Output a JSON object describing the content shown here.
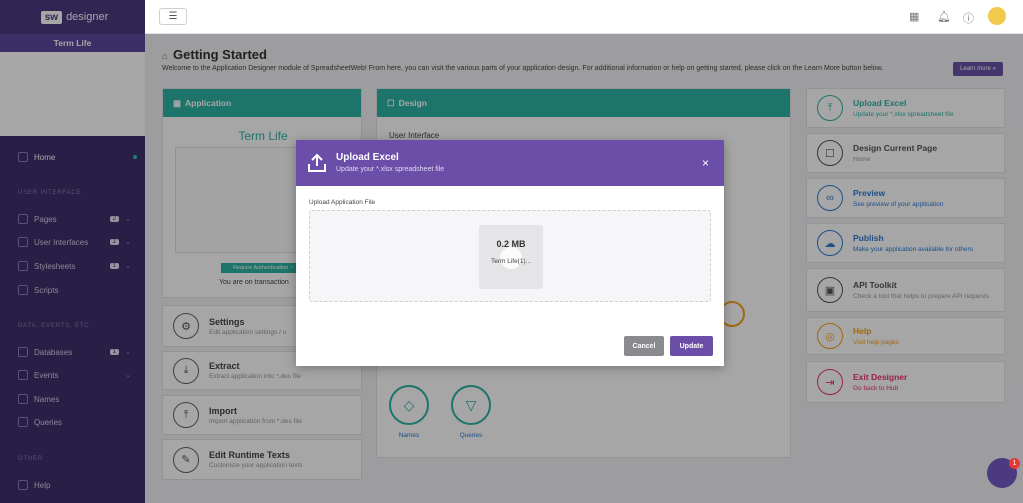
{
  "sidebar": {
    "brand_badge": "sw",
    "brand_text": "designer",
    "app_title": "Term Life",
    "items": [
      {
        "label": "Home"
      },
      {
        "label": "Pages",
        "count": "2"
      },
      {
        "label": "User Interfaces",
        "count": "2"
      },
      {
        "label": "Stylesheets",
        "count": "1"
      },
      {
        "label": "Scripts"
      },
      {
        "label": "Databases",
        "count": "1"
      },
      {
        "label": "Events"
      },
      {
        "label": "Names"
      },
      {
        "label": "Queries"
      },
      {
        "label": "Help"
      }
    ],
    "sections": {
      "ui": "USER INTERFACE",
      "data": "DATA, EVENTS, ETC",
      "other": "OTHER"
    }
  },
  "header": {
    "title": "Getting Started",
    "desc": "Welcome to the Application Designer module of SpreadsheetWeb! From here, you can visit the various parts of your application design. For additional information or help on getting started, please click on the Learn More button below.",
    "learn_more": "Learn more »"
  },
  "application_card": {
    "head": "Application",
    "app_name": "Term Life",
    "auth_button": "Require Authentication ~",
    "transaction": "You are on transaction"
  },
  "design_card": {
    "head": "Design",
    "ui_label": "User Interface",
    "names": "Names",
    "queries": "Queries"
  },
  "left_tools": [
    {
      "title": "Settings",
      "desc": "Edit application settings / u"
    },
    {
      "title": "Extract",
      "desc": "Extract application into *.des file"
    },
    {
      "title": "Import",
      "desc": "Import application from *.des file"
    },
    {
      "title": "Edit Runtime Texts",
      "desc": "Customize your application texts"
    }
  ],
  "right_tools": [
    {
      "title": "Upload Excel",
      "desc": "Update your *.xlsx spreadsheet file",
      "color": "#2bb3a3"
    },
    {
      "title": "Design Current Page",
      "desc": "Home",
      "color": "#555555"
    },
    {
      "title": "Preview",
      "desc": "See preview of your application",
      "color": "#2b7bd6"
    },
    {
      "title": "Publish",
      "desc": "Make your application available for others",
      "color": "#2b7bd6"
    },
    {
      "title": "API Toolkit",
      "desc": "Check a tool that helps to prepare API requests",
      "color": "#555555"
    },
    {
      "title": "Help",
      "desc": "Visit help pages",
      "color": "#f2a31b"
    },
    {
      "title": "Exit Designer",
      "desc": "Go back to Hub",
      "color": "#e8336c"
    }
  ],
  "modal": {
    "title": "Upload Excel",
    "subtitle": "Update your *.xlsx spreadsheet file",
    "close": "×",
    "field_label": "Upload Application File",
    "file_size": "0.2 MB",
    "file_name": "Term Life(1)...",
    "cancel": "Cancel",
    "update": "Update"
  },
  "chat_badge": "1"
}
